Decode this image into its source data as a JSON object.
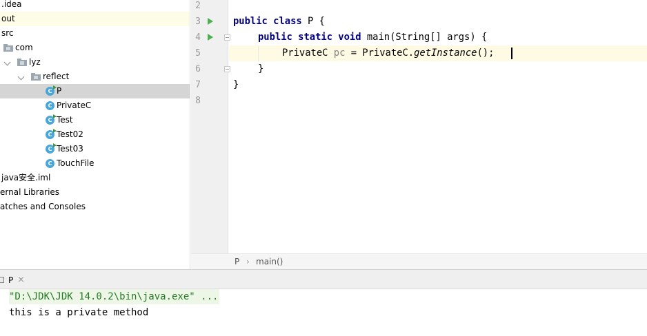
{
  "project_tree": {
    "items": [
      {
        "label": ".idea"
      },
      {
        "label": "out"
      },
      {
        "label": "src"
      },
      {
        "label": "com"
      },
      {
        "label": "lyz"
      },
      {
        "label": "reflect"
      },
      {
        "label": "P"
      },
      {
        "label": "PrivateC"
      },
      {
        "label": "Test"
      },
      {
        "label": "Test02"
      },
      {
        "label": "Test03"
      },
      {
        "label": "TouchFile"
      },
      {
        "label": "java安全.iml"
      },
      {
        "label": "ernal Libraries"
      },
      {
        "label": "atches and Consoles"
      }
    ],
    "class_icon_letter": "C"
  },
  "editor": {
    "line_numbers": [
      "2",
      "3",
      "4",
      "5",
      "6",
      "7",
      "8"
    ],
    "code": {
      "l3_kw": "public class",
      "l3_rest": " P {",
      "l4_kw": "public static void",
      "l4_rest": " main(String[] args) {",
      "l5_type": "PrivateC ",
      "l5_var": "pc",
      "l5_mid": " = PrivateC.",
      "l5_method": "getInstance",
      "l5_end": "();",
      "l6": "}",
      "l7": "}"
    }
  },
  "breadcrumb": {
    "items": [
      "P",
      "main()"
    ],
    "separator": "›"
  },
  "run_panel": {
    "tab_label": "P",
    "close_glyph": "×",
    "console_lines": [
      "\"D:\\JDK\\JDK 14.0.2\\bin\\java.exe\" ...",
      "this is a private method"
    ]
  },
  "colors": {
    "keyword": "#000080",
    "run_green": "#4caf50",
    "class_icon": "#48a7d8",
    "selection": "#d5d5d5",
    "caret_line": "#fffae3",
    "console_command": "#227a22"
  }
}
